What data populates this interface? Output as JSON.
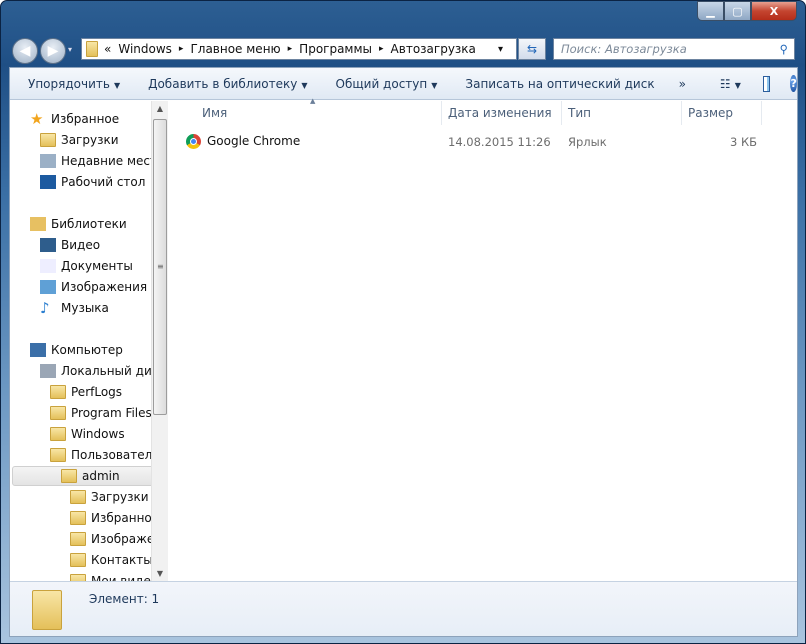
{
  "window": {
    "min": "▁",
    "max": "▢",
    "close": "X"
  },
  "address": {
    "chevrons": "«",
    "crumbs": [
      "Windows",
      "Главное меню",
      "Программы",
      "Автозагрузка"
    ],
    "sep": "▸",
    "dropdown": "▾"
  },
  "search": {
    "placeholder": "Поиск: Автозагрузка"
  },
  "toolbar": {
    "organize": "Упорядочить",
    "add_library": "Добавить в библиотеку",
    "share": "Общий доступ",
    "burn": "Записать на оптический диск",
    "more": "»",
    "help": "?"
  },
  "nav": {
    "items": [
      {
        "label": "Избранное",
        "icon": "star-icon"
      },
      {
        "label": "Загрузки",
        "icon": "downloads-folder-icon"
      },
      {
        "label": "Недавние места",
        "icon": "recent-places-icon"
      },
      {
        "label": "Рабочий стол",
        "icon": "desktop-icon"
      },
      {
        "label": "Библиотеки",
        "icon": "libraries-icon"
      },
      {
        "label": "Видео",
        "icon": "video-icon"
      },
      {
        "label": "Документы",
        "icon": "documents-icon"
      },
      {
        "label": "Изображения",
        "icon": "pictures-icon"
      },
      {
        "label": "Музыка",
        "icon": "music-icon"
      },
      {
        "label": "Компьютер",
        "icon": "computer-icon"
      },
      {
        "label": "Локальный диск",
        "icon": "drive-icon"
      },
      {
        "label": "PerfLogs",
        "icon": "folder-icon"
      },
      {
        "label": "Program Files",
        "icon": "folder-icon"
      },
      {
        "label": "Windows",
        "icon": "folder-icon"
      },
      {
        "label": "Пользователи",
        "icon": "folder-icon"
      },
      {
        "label": "admin",
        "icon": "locked-folder-icon"
      },
      {
        "label": "Загрузки",
        "icon": "downloads-folder-icon"
      },
      {
        "label": "Избранное",
        "icon": "favorites-folder-icon"
      },
      {
        "label": "Изображения",
        "icon": "pictures-folder-icon"
      },
      {
        "label": "Контакты",
        "icon": "contacts-folder-icon"
      },
      {
        "label": "Мои видео",
        "icon": "videos-folder-icon"
      }
    ]
  },
  "columns": {
    "name": "Имя",
    "date": "Дата изменения",
    "type": "Тип",
    "size": "Размер"
  },
  "files": [
    {
      "name": "Google Chrome",
      "date": "14.08.2015 11:26",
      "type": "Ярлык",
      "size": "3 КБ"
    }
  ],
  "status": {
    "count": "Элемент: 1"
  }
}
